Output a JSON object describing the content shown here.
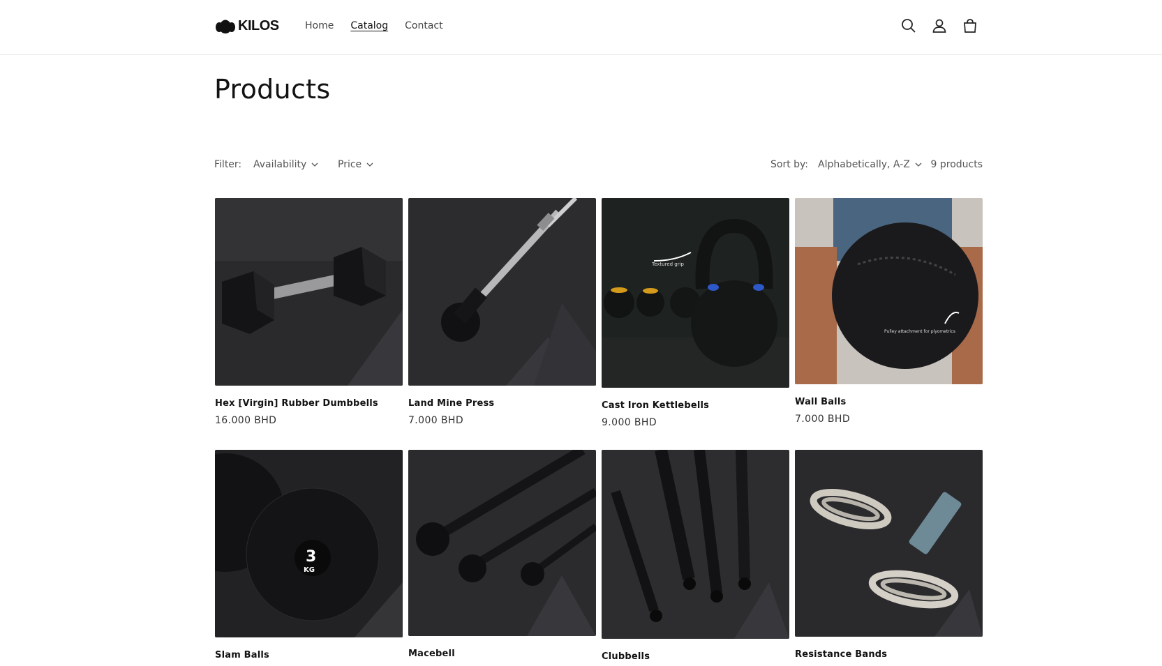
{
  "brand": {
    "name": "KILOS"
  },
  "nav": [
    {
      "label": "Home"
    },
    {
      "label": "Catalog"
    },
    {
      "label": "Contact"
    }
  ],
  "header_icons": [
    "search-icon",
    "account-icon",
    "cart-icon"
  ],
  "page": {
    "title": "Products"
  },
  "filters": {
    "label": "Filter:",
    "availability": "Availability",
    "price": "Price",
    "sort_label": "Sort by:",
    "sort_value": "Alphabetically, A-Z",
    "count": "9 products"
  },
  "products": [
    {
      "title": "Hex [Virgin] Rubber Dumbbells",
      "price": "16.000 BHD"
    },
    {
      "title": "Land Mine Press",
      "price": "7.000 BHD"
    },
    {
      "title": "Cast Iron Kettlebells",
      "price": "9.000 BHD"
    },
    {
      "title": "Wall Balls",
      "price": "7.000 BHD"
    },
    {
      "title": "Slam Balls",
      "price": ""
    },
    {
      "title": "Macebell",
      "price": ""
    },
    {
      "title": "Clubbells",
      "price": ""
    },
    {
      "title": "Resistance Bands",
      "price": ""
    }
  ],
  "colors": {
    "accent": "#121212",
    "image_bg": "#2b2b2e"
  }
}
